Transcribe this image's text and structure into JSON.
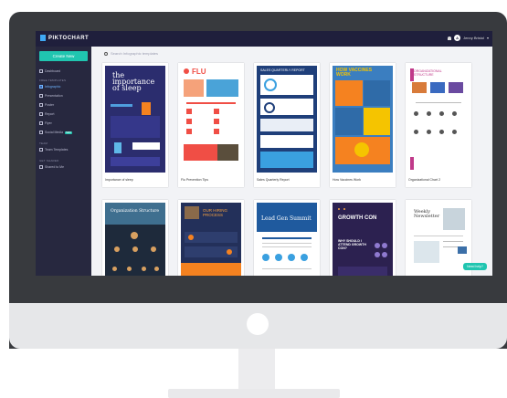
{
  "app": {
    "logo": "PIKTOCHART",
    "user_initial": "A",
    "user_name": "Jenny Bristol"
  },
  "sidebar": {
    "create_label": "Create New",
    "dashboard": "Dashboard",
    "section_templates": "FREE TEMPLATES",
    "items": [
      {
        "label": "Infographic"
      },
      {
        "label": "Presentation"
      },
      {
        "label": "Poster"
      },
      {
        "label": "Report"
      },
      {
        "label": "Flyer"
      },
      {
        "label": "Social Media",
        "badge": "NEW"
      }
    ],
    "section_team": "TEAM",
    "team_templates": "Team Templates",
    "section_shared": "GET SHARED",
    "shared_item": "Shared to Me"
  },
  "search": {
    "placeholder": "Search Infographic templates"
  },
  "cards": [
    {
      "caption": "Importance of sleep",
      "title": "the importance of sleep",
      "bg": "#2b2d6e"
    },
    {
      "caption": "Flu Prevention Tips",
      "title": "FLU",
      "bg": "#ffffff"
    },
    {
      "caption": "Sales Quarterly Report",
      "title": "SALES QUARTERLY REPORT",
      "bg": "#1f3f7a"
    },
    {
      "caption": "How Vaccines Work",
      "title": "HOW VACCINES WORK",
      "bg": "#3b7ec0"
    },
    {
      "caption": "Organizational Chart 2",
      "title": "ORGANIZATIONAL STRUCTURE",
      "bg": "#ffffff"
    },
    {
      "caption": "",
      "title": "Organization Structure",
      "bg": "#1e2a3b"
    },
    {
      "caption": "",
      "title": "OUR HIRING PROCESS",
      "bg": "#23305a"
    },
    {
      "caption": "",
      "title": "Lead Gen Summit",
      "bg": "#1f5a9e"
    },
    {
      "caption": "",
      "title": "GROWTH CON",
      "title2": "WHY SHOULD I ATTEND GROWTH CON?",
      "bg": "#2c2150"
    },
    {
      "caption": "",
      "title": "Weekly Newsletter",
      "bg": "#ffffff"
    }
  ],
  "help_label": "Need help?",
  "colors": {
    "accent": "#20c5b0",
    "topbar": "#1f1f3c",
    "sidebar": "#27283f",
    "frame": "#383a3e"
  }
}
